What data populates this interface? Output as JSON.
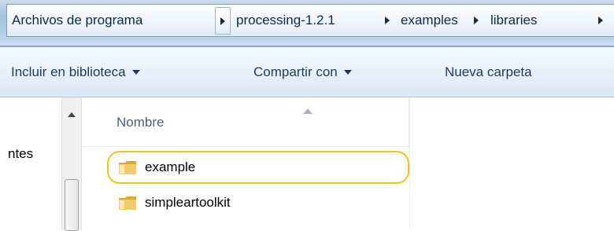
{
  "breadcrumbs": [
    {
      "label": "Archivos de programa"
    },
    {
      "label": "processing-1.2.1"
    },
    {
      "label": "examples"
    },
    {
      "label": "libraries"
    }
  ],
  "toolbar": {
    "include_label": "Incluir en biblioteca",
    "share_label": "Compartir con",
    "new_folder_label": "Nueva carpeta"
  },
  "nav_pane": {
    "partial_item": "ntes"
  },
  "file_list": {
    "column_name": "Nombre",
    "items": [
      {
        "name": "example",
        "icon": "folder-icon"
      },
      {
        "name": "simpleartoolkit",
        "icon": "folder-icon"
      }
    ]
  },
  "colors": {
    "highlight": "#f2c21a",
    "folder": "#e8c15a"
  }
}
